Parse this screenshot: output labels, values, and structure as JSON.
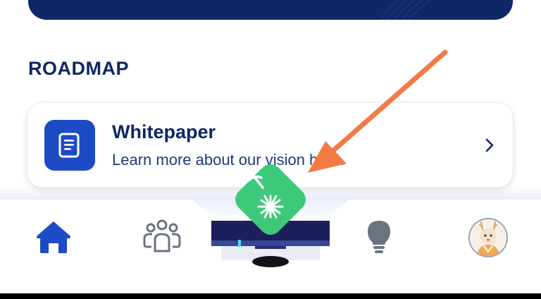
{
  "section": {
    "title": "ROADMAP"
  },
  "card": {
    "title": "Whitepaper",
    "description": "Learn more about our vision here.",
    "icon": "document-icon",
    "accent": "#1d4bc6"
  },
  "nav": {
    "items": [
      {
        "name": "home",
        "icon": "home-icon",
        "active": true
      },
      {
        "name": "community",
        "icon": "people-icon",
        "active": false
      },
      {
        "name": "mine",
        "icon": "mining-pickaxe-icon",
        "active": false
      },
      {
        "name": "ideas",
        "icon": "lightbulb-icon",
        "active": false
      },
      {
        "name": "profile",
        "icon": "avatar",
        "active": false
      }
    ]
  },
  "colors": {
    "navy": "#0f2766",
    "primary": "#1d4bc6",
    "mine_green": "#3ec97a",
    "annotation_arrow": "#f47a44",
    "inactive_icon": "#6b7280"
  }
}
